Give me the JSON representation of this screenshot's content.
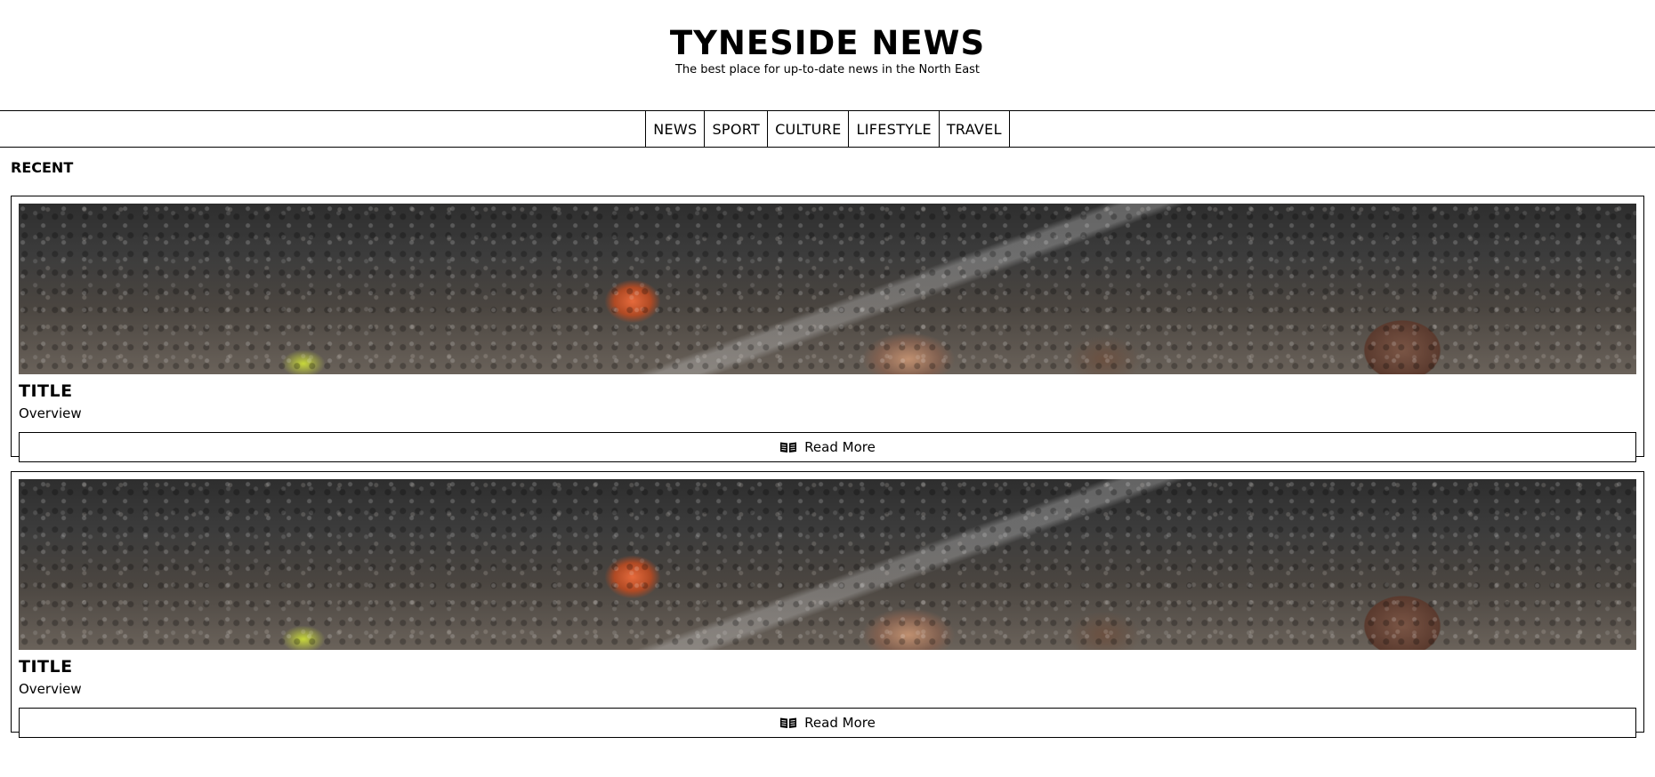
{
  "site": {
    "title": "TYNESIDE NEWS",
    "tagline": "The best place for up-to-date news in the North East"
  },
  "nav": {
    "items": [
      {
        "label": "NEWS"
      },
      {
        "label": "SPORT"
      },
      {
        "label": "CULTURE"
      },
      {
        "label": "LIFESTYLE"
      },
      {
        "label": "TRAVEL"
      }
    ]
  },
  "recent": {
    "heading": "RECENT",
    "articles": [
      {
        "image_icon": "football-celebration-photo",
        "title": "TITLE",
        "overview": "Overview",
        "read_more_label": "Read More",
        "read_more_icon": "open-book-icon"
      },
      {
        "image_icon": "football-celebration-photo",
        "title": "TITLE",
        "overview": "Overview",
        "read_more_label": "Read More",
        "read_more_icon": "open-book-icon"
      }
    ]
  },
  "colors": {
    "text": "#000000",
    "background": "#ffffff",
    "border": "#000000"
  }
}
